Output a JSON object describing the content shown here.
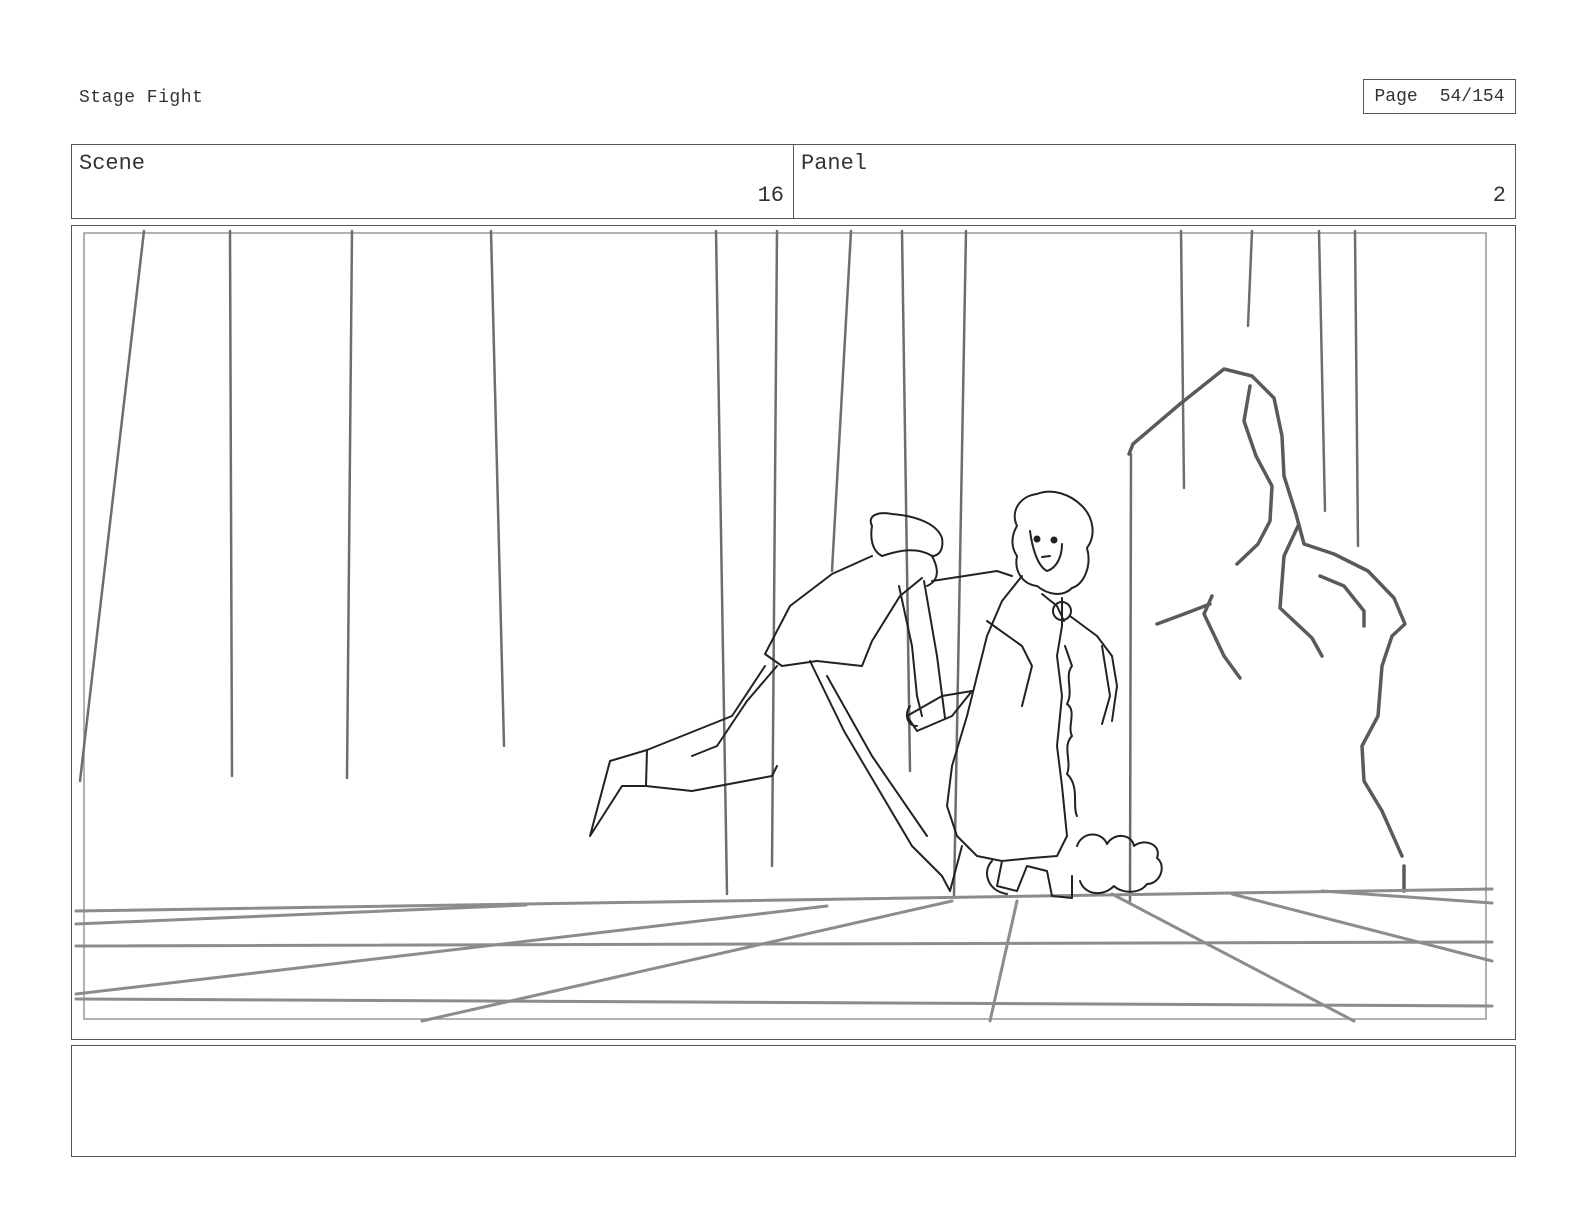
{
  "document": {
    "title": "Stage Fight"
  },
  "page": {
    "label": "Page",
    "number": "54/154"
  },
  "header": {
    "scene_label": "Scene",
    "scene_value": "16",
    "panel_label": "Panel",
    "panel_value": "2"
  },
  "panel_image": {
    "subject": "storyboard-sketch"
  },
  "notes": {
    "text": ""
  }
}
